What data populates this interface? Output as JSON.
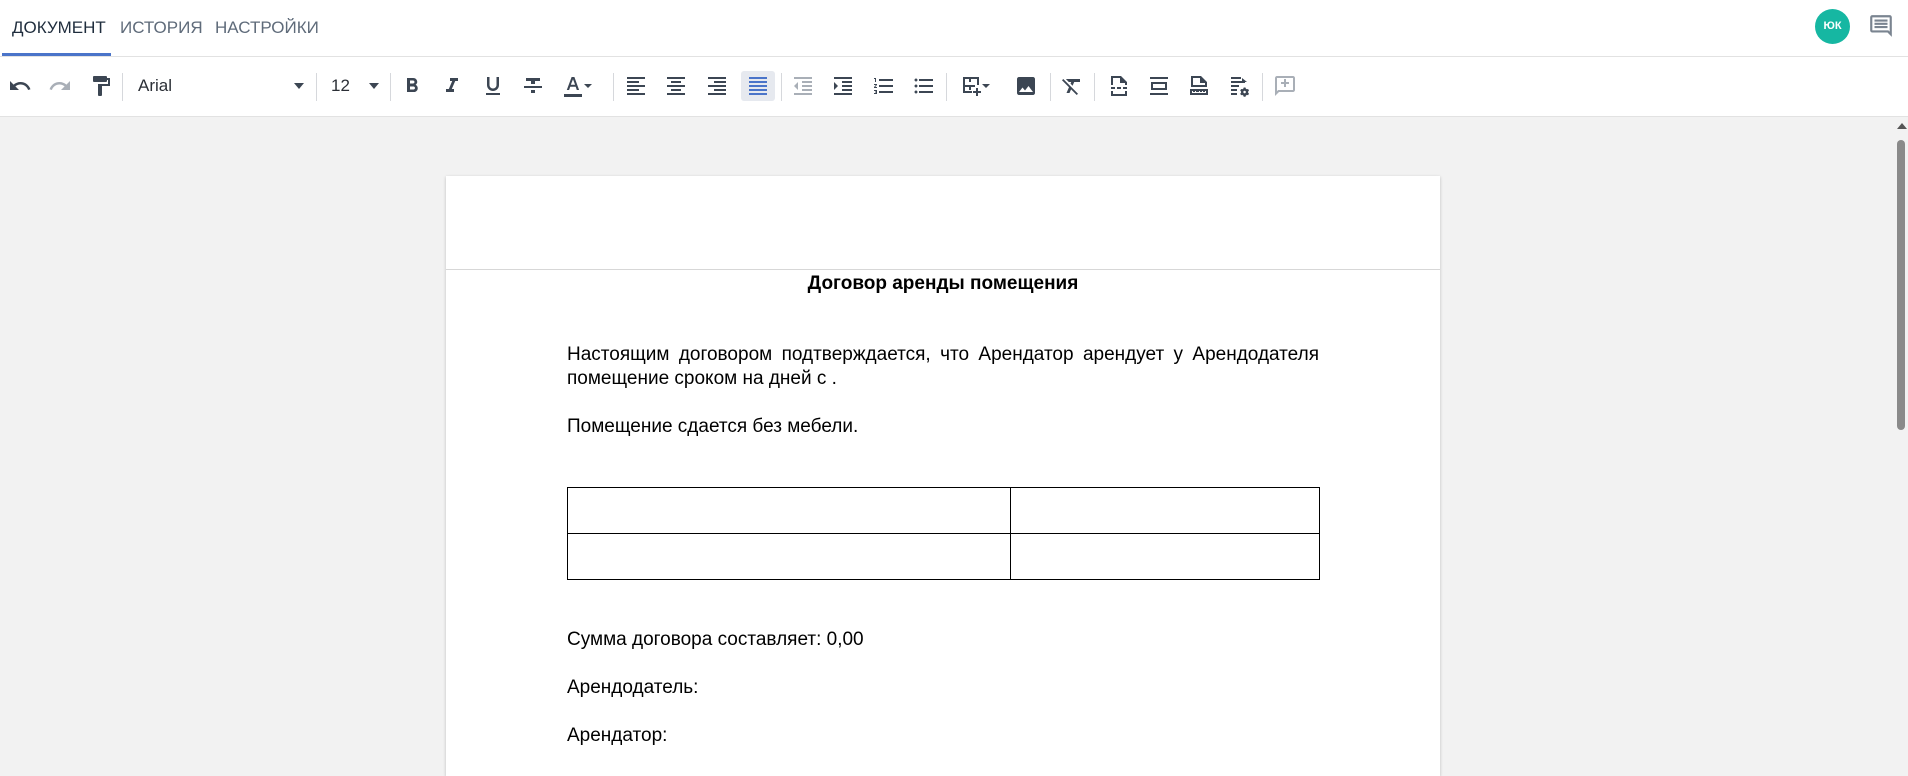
{
  "tabs": [
    {
      "label": "ДОКУМЕНТ",
      "active": true
    },
    {
      "label": "ИСТОРИЯ",
      "active": false
    },
    {
      "label": "НАСТРОЙКИ",
      "active": false
    }
  ],
  "user": {
    "initials": "ЮК",
    "avatar_color": "#16b7a2"
  },
  "toolbar": {
    "font_family": "Arial",
    "font_size": "12",
    "active_alignment": "justify",
    "accent_color": "#4a74c9"
  },
  "document": {
    "title": "Договор аренды помещения",
    "paragraph1": "Настоящим договором подтверждается, что Арендатор арендует у Арендодателя  помещение сроком на  дней с .",
    "paragraph2": "Помещение сдается без мебели.",
    "table": {
      "rows": 2,
      "cols": 2
    },
    "sum_line": "Сумма договора составляет: 0,00",
    "landlord_line": "Арендодатель:",
    "tenant_line": "Арендатор:"
  }
}
